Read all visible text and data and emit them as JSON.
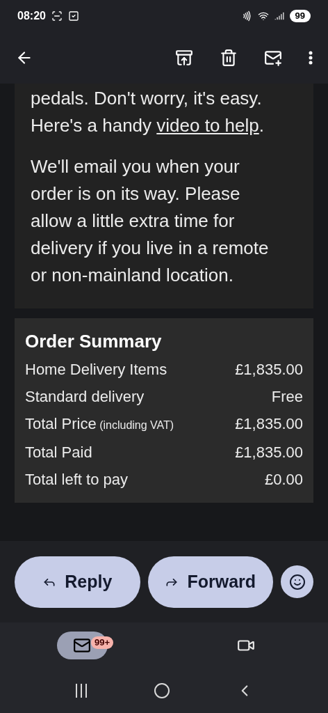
{
  "status_bar": {
    "time": "08:20",
    "battery": "99"
  },
  "body": {
    "paragraphs": [
      {
        "text": "pedals. Don't worry, it's easy. Here's a handy ",
        "link": "video to help",
        "after": "."
      },
      {
        "text": "We'll email you when your order is on its way. Please allow a little extra time for delivery if you live in a remote or non-mainland location."
      }
    ]
  },
  "order_summary": {
    "title": "Order Summary",
    "rows": [
      {
        "label": "Home Delivery Items",
        "value": "£1,835.00"
      },
      {
        "label": "Standard delivery",
        "value": "Free"
      },
      {
        "label": "Total Price",
        "note": "(including VAT)",
        "value": "£1,835.00"
      },
      {
        "label": "Total Paid",
        "value": "£1,835.00"
      },
      {
        "label": "Total left to pay",
        "value": "£0.00"
      }
    ]
  },
  "actions": [
    {
      "kind": "reply",
      "label": "Reply"
    },
    {
      "kind": "forward",
      "label": "Forward"
    }
  ],
  "bottom_nav": [
    {
      "kind": "mail",
      "selected": true,
      "badge": "99+"
    },
    {
      "kind": "meet",
      "selected": false
    }
  ]
}
